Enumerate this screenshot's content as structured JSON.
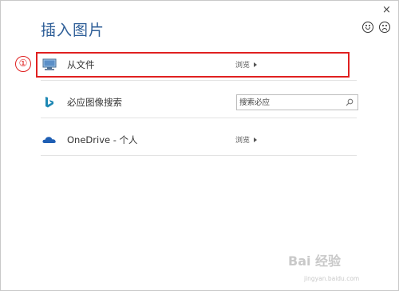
{
  "dialog": {
    "title": "插入图片",
    "close_glyph": "×"
  },
  "annotation": {
    "step_number": "①",
    "color": "#e02020"
  },
  "rows": [
    {
      "label": "从文件",
      "action": "浏览",
      "icon": "computer-icon"
    },
    {
      "label": "必应图像搜索",
      "search_placeholder": "搜索必应",
      "icon": "bing-icon"
    },
    {
      "label": "OneDrive - 个人",
      "action": "浏览",
      "icon": "onedrive-cloud-icon"
    }
  ],
  "colors": {
    "title": "#2f5f98",
    "bing": "#1e88b4",
    "onedrive": "#1f5fb4"
  },
  "watermark": {
    "brand": "Bai 经验",
    "url": "jingyan.baidu.com"
  }
}
